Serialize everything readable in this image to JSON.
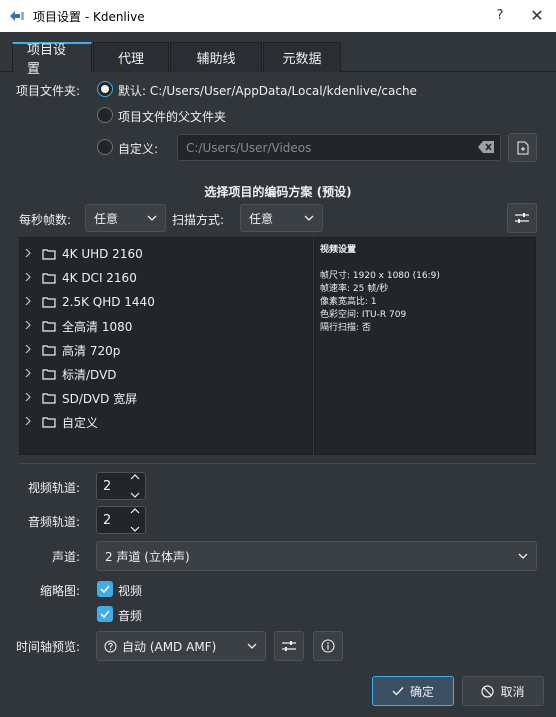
{
  "window": {
    "title": "项目设置 - Kdenlive",
    "help_glyph": "?",
    "close_glyph": "✕"
  },
  "tabs": [
    {
      "label": "项目设置",
      "active": true
    },
    {
      "label": "代理",
      "active": false
    },
    {
      "label": "辅助线",
      "active": false
    },
    {
      "label": "元数据",
      "active": false
    }
  ],
  "folder": {
    "label": "项目文件夹:",
    "option_default": "默认: C:/Users/User/AppData/Local/kdenlive/cache",
    "option_parent": "项目文件的父文件夹",
    "option_custom": "自定义:",
    "custom_path": "C:/Users/User/Videos",
    "selected": "default"
  },
  "profile": {
    "section_title": "选择项目的编码方案 (预设)",
    "fps_label": "每秒帧数:",
    "fps_value": "任意",
    "scan_label": "扫描方式:",
    "scan_value": "任意",
    "tree_items": [
      "4K UHD 2160",
      "4K DCI 2160",
      "2.5K QHD 1440",
      "全高清 1080",
      "高清 720p",
      "标清/DVD",
      "SD/DVD 宽屏",
      "自定义"
    ],
    "info": {
      "heading": "视频设置",
      "lines": [
        "帧尺寸: 1920 x 1080 (16:9)",
        "帧速率: 25 帧/秒",
        "像素宽高比: 1",
        "色彩空间: ITU-R 709",
        "隔行扫描: 否"
      ]
    }
  },
  "tracks": {
    "video_label": "视频轨道:",
    "video_value": "2",
    "audio_label": "音频轨道:",
    "audio_value": "2"
  },
  "channels": {
    "label": "声道:",
    "value": "2 声道 (立体声)"
  },
  "thumbnails": {
    "label": "缩略图:",
    "video": "视频",
    "audio": "音频",
    "video_checked": true,
    "audio_checked": true
  },
  "preview": {
    "label": "时间轴预览:",
    "value": "自动 (AMD AMF)"
  },
  "buttons": {
    "ok": "确定",
    "cancel": "取消"
  },
  "colors": {
    "accent": "#3daee9",
    "background": "#31363b",
    "field": "#232629"
  }
}
